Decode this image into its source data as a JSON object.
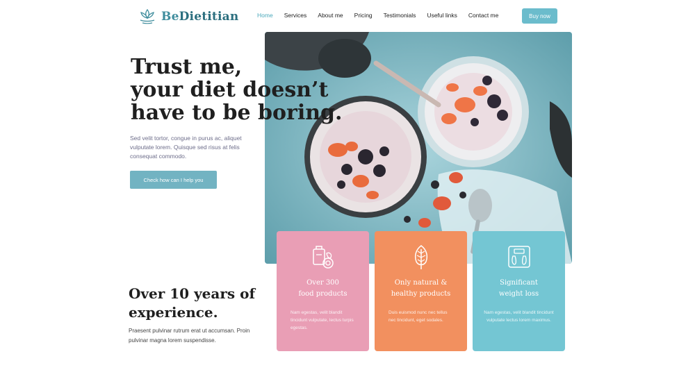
{
  "brand": {
    "name_part1": "Be",
    "name_part2": "Dietitian"
  },
  "nav": {
    "items": [
      {
        "label": "Home",
        "active": true
      },
      {
        "label": "Services",
        "active": false
      },
      {
        "label": "About me",
        "active": false
      },
      {
        "label": "Pricing",
        "active": false
      },
      {
        "label": "Testimonials",
        "active": false
      },
      {
        "label": "Useful links",
        "active": false
      },
      {
        "label": "Contact me",
        "active": false
      }
    ],
    "buy_label": "Buy now"
  },
  "hero": {
    "title_lines": [
      "Trust me,",
      "your diet doesn’t",
      "have to be boring."
    ],
    "subtitle": "Sed velit tortor, congue in purus ac, aliquet vulputate lorem. Quisque sed risus at felis consequat commodo.",
    "cta_label": "Check how can I help you",
    "image_icon": "breakfast-bowls-photo"
  },
  "experience": {
    "title_lines": [
      "Over 10 years of",
      "experience."
    ],
    "text": "Praesent pulvinar rutrum erat ut accumsan. Proin pulvinar magna lorem suspendisse."
  },
  "cards": [
    {
      "icon": "food-products-icon",
      "color": "#e99eb5",
      "title_lines": [
        "Over 300",
        "food products"
      ],
      "text": "Nam egestas, velit blandit tincidunt vulputate, lectus turpis egestas."
    },
    {
      "icon": "natural-products-icon",
      "color": "#f2905f",
      "title_lines": [
        "Only natural &",
        "healthy products"
      ],
      "text": "Duis euismod nunc nec tellus nec tincidunt, eget sodales."
    },
    {
      "icon": "scale-icon",
      "color": "#74c6d3",
      "title_lines": [
        "Significant",
        "weight loss"
      ],
      "text": "Nam egestas, velit blandit tincidunt vulputate lectus lorem maximus."
    }
  ],
  "colors": {
    "accent": "#6bbccc",
    "pink": "#e99eb5",
    "orange": "#f2905f",
    "teal": "#74c6d3"
  }
}
